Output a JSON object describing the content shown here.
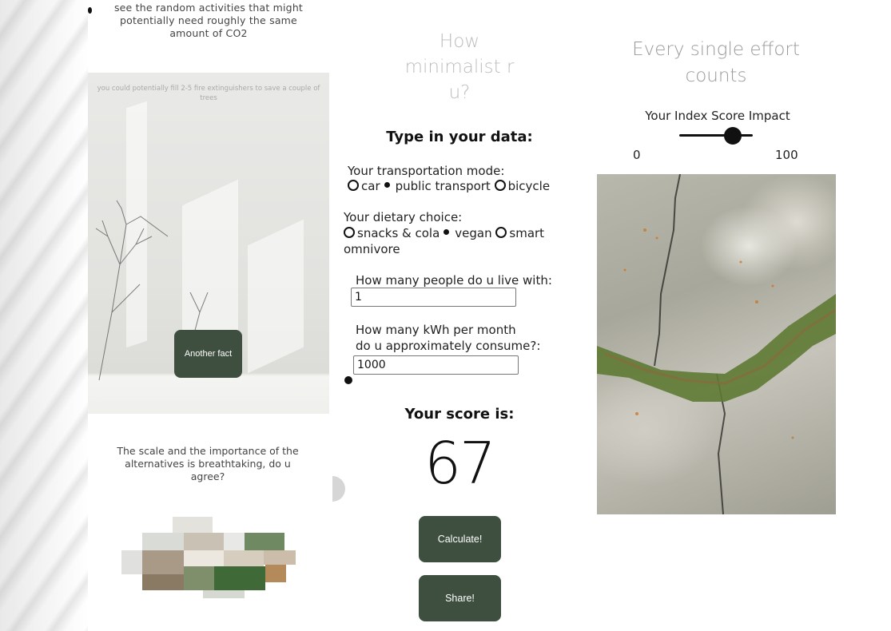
{
  "left_column": {
    "intro_text": "see the random activities that might potentially need roughly the same amount of CO2",
    "fact_text": "you could potentially fill 2-5 fire extinguishers to save a couple of trees",
    "another_fact_button": "Another fact",
    "question_text": "The scale and the importance of the alternatives is breathtaking, do u agree?"
  },
  "calculator": {
    "title": "How minimalist r u?",
    "form_heading": "Type in your data:",
    "transport": {
      "label": "Your transportation mode:",
      "options": [
        "car",
        "public transport",
        "bicycle"
      ],
      "selected": "public transport"
    },
    "diet": {
      "label": "Your dietary choice:",
      "options": [
        "snacks & cola",
        "vegan",
        "smart omnivore"
      ],
      "selected": "vegan"
    },
    "people": {
      "label": "How many people do u live with:",
      "value": "1"
    },
    "kwh": {
      "label_line1": "How many kWh per month",
      "label_line2": "do u approximately consume?:",
      "value": "1000"
    },
    "score_heading": "Your score is:",
    "score_value": "67",
    "calculate_button": "Calculate!",
    "share_button": "Share!"
  },
  "impact": {
    "title": "Every single effort counts",
    "slider_label": "Your Index Score Impact",
    "slider_min": "0",
    "slider_max": "100",
    "slider_value_fraction": 0.67
  },
  "colors": {
    "button_bg": "#3e4f3f",
    "button_text": "#ffffff"
  }
}
